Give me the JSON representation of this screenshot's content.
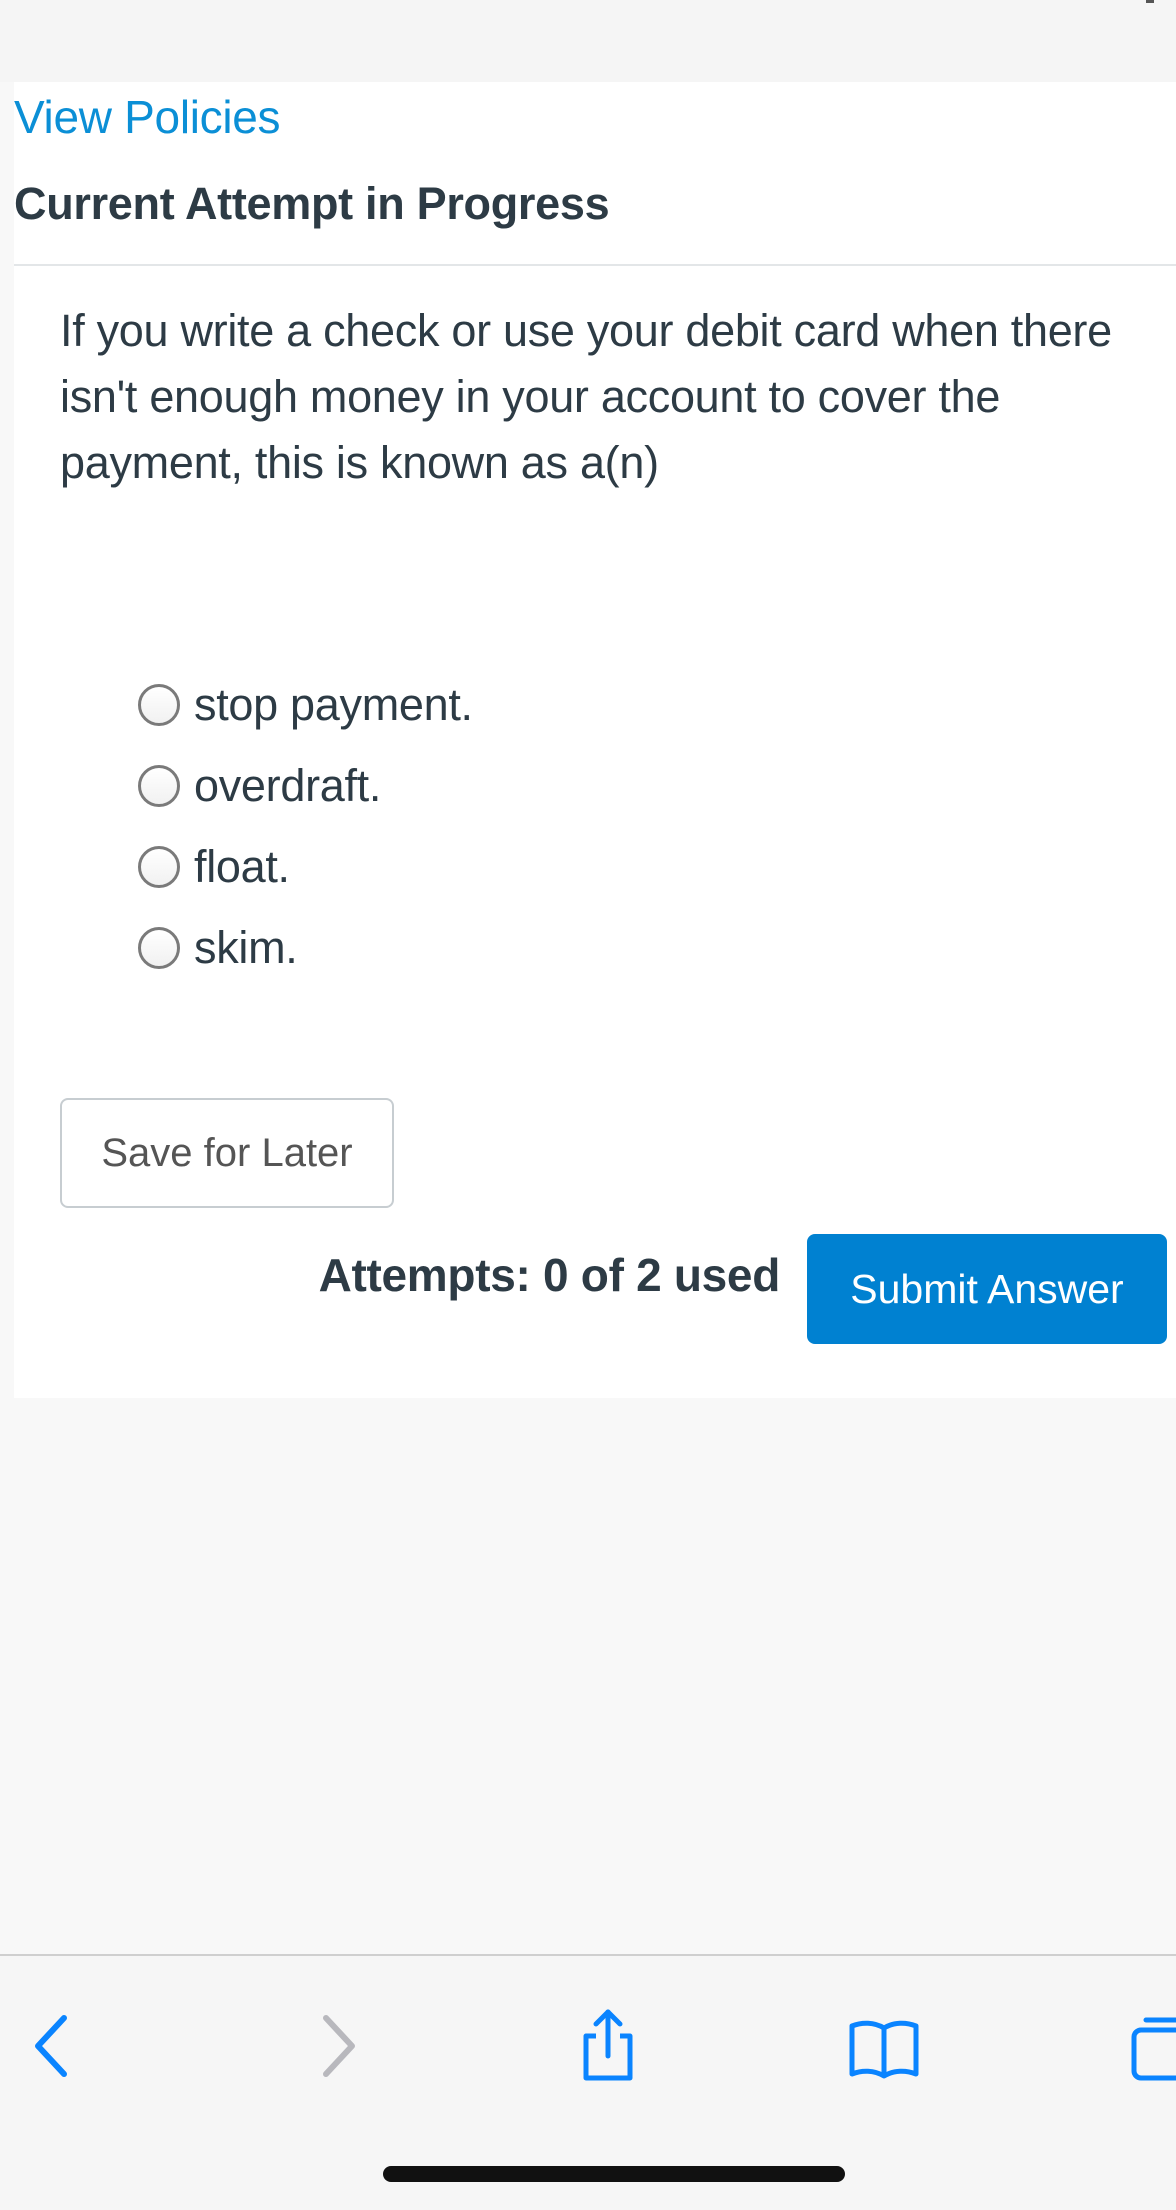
{
  "header": {
    "view_policies": "View Policies",
    "attempt_title": "Current Attempt in Progress"
  },
  "question": {
    "text": "If you write a check or use your debit card when there isn't enough money in your account to cover the payment, this is known as a(n)",
    "options": [
      {
        "label": "stop payment.",
        "selected": false
      },
      {
        "label": "overdraft.",
        "selected": false
      },
      {
        "label": "float.",
        "selected": false
      },
      {
        "label": "skim.",
        "selected": false
      }
    ]
  },
  "actions": {
    "save_label": "Save for Later",
    "attempts_label": "Attempts: 0 of 2 used",
    "submit_label": "Submit Answer"
  },
  "browser_toolbar": {
    "icons": [
      "back-icon",
      "forward-icon",
      "share-icon",
      "bookmarks-icon",
      "tabs-icon"
    ]
  },
  "colors": {
    "link": "#0b8fd6",
    "primary_button": "#0081d1",
    "text": "#2d3b45"
  }
}
